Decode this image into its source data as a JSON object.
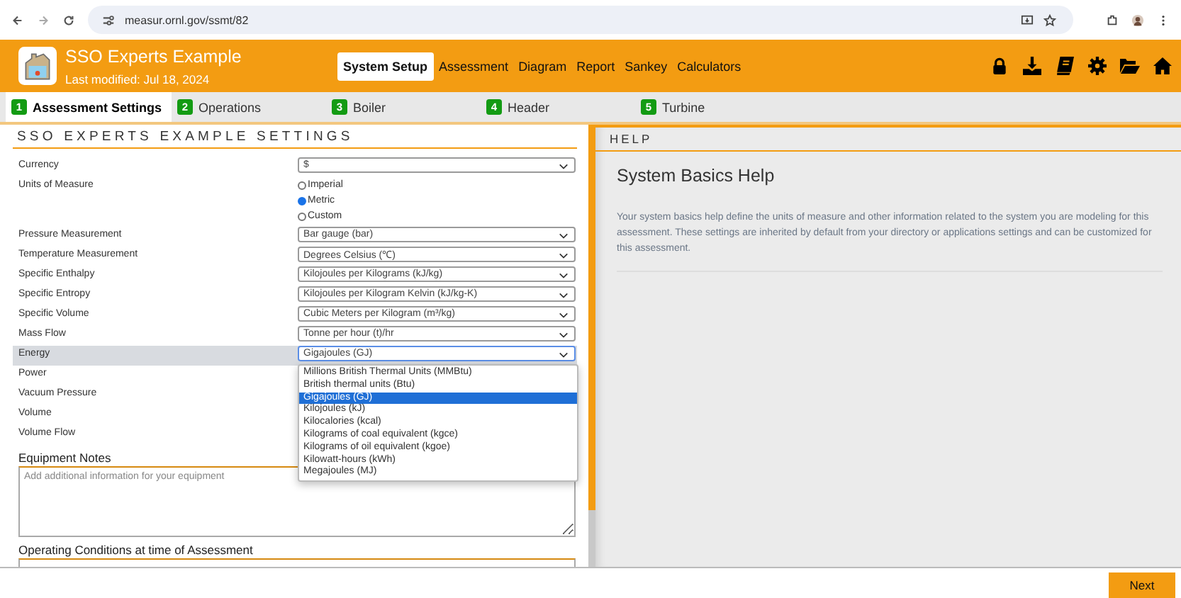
{
  "browser": {
    "url": "measur.ornl.gov/ssmt/82"
  },
  "header": {
    "title": "SSO Experts Example",
    "subtitle": "Last modified: Jul 18, 2024",
    "nav": [
      {
        "label": "System Setup",
        "selected": true
      },
      {
        "label": "Assessment",
        "selected": false
      },
      {
        "label": "Diagram",
        "selected": false
      },
      {
        "label": "Report",
        "selected": false
      },
      {
        "label": "Sankey",
        "selected": false
      },
      {
        "label": "Calculators",
        "selected": false
      }
    ]
  },
  "steps": [
    {
      "number": "1",
      "label": "Assessment Settings",
      "selected": true
    },
    {
      "number": "2",
      "label": "Operations",
      "selected": false
    },
    {
      "number": "3",
      "label": "Boiler",
      "selected": false
    },
    {
      "number": "4",
      "label": "Header",
      "selected": false
    },
    {
      "number": "5",
      "label": "Turbine",
      "selected": false
    }
  ],
  "settings": {
    "title": "SSO EXPERTS EXAMPLE SETTINGS",
    "fields": [
      {
        "kind": "select",
        "label": "Currency",
        "value": "$",
        "highlighted": false
      },
      {
        "kind": "radio",
        "label": "Units of Measure",
        "highlighted": false,
        "options": [
          {
            "label": "Imperial",
            "selected": false
          },
          {
            "label": "Metric",
            "selected": true
          },
          {
            "label": "Custom",
            "selected": false
          }
        ]
      },
      {
        "kind": "select",
        "label": "Pressure Measurement",
        "value": "Bar gauge (bar)",
        "highlighted": false
      },
      {
        "kind": "select",
        "label": "Temperature Measurement",
        "value": "Degrees Celsius (℃)",
        "highlighted": false
      },
      {
        "kind": "select",
        "label": "Specific Enthalpy",
        "value": "Kilojoules per Kilograms (kJ/kg)",
        "highlighted": false
      },
      {
        "kind": "select",
        "label": "Specific Entropy",
        "value": "Kilojoules per Kilogram Kelvin (kJ/kg-K)",
        "highlighted": false
      },
      {
        "kind": "select",
        "label": "Specific Volume",
        "value": "Cubic Meters per Kilogram (m³/kg)",
        "highlighted": false
      },
      {
        "kind": "select",
        "label": "Mass Flow",
        "value": "Tonne per hour (t)/hr",
        "highlighted": false
      },
      {
        "kind": "open-select",
        "label": "Energy",
        "value": "Gigajoules (GJ)",
        "highlighted": true,
        "options": [
          {
            "label": "Millions British Thermal Units (MMBtu)",
            "selected": false
          },
          {
            "label": "British thermal units (Btu)",
            "selected": false
          },
          {
            "label": "Gigajoules (GJ)",
            "selected": true
          },
          {
            "label": "Kilojoules (kJ)",
            "selected": false
          },
          {
            "label": "Kilocalories (kcal)",
            "selected": false
          },
          {
            "label": "Kilograms of coal equivalent (kgce)",
            "selected": false
          },
          {
            "label": "Kilograms of oil equivalent (kgoe)",
            "selected": false
          },
          {
            "label": "Kilowatt-hours (kWh)",
            "selected": false
          },
          {
            "label": "Megajoules (MJ)",
            "selected": false
          }
        ]
      },
      {
        "kind": "covered",
        "label": "Power",
        "highlighted": false
      },
      {
        "kind": "covered",
        "label": "Vacuum Pressure",
        "highlighted": false
      },
      {
        "kind": "covered",
        "label": "Volume",
        "highlighted": false
      },
      {
        "kind": "covered",
        "label": "Volume Flow",
        "highlighted": false
      }
    ],
    "notes": [
      {
        "label": "Equipment Notes",
        "placeholder": "Add additional information for your equipment"
      },
      {
        "label": "Operating Conditions at time of Assessment"
      }
    ]
  },
  "help": {
    "header": "HELP",
    "title": "System Basics Help",
    "text": "Your system basics help define the units of measure and other information related to the system you are modeling for this assessment. These settings are inherited by default from your directory or applications settings and can be customized for this assessment."
  },
  "footer": {
    "button": "Next"
  }
}
